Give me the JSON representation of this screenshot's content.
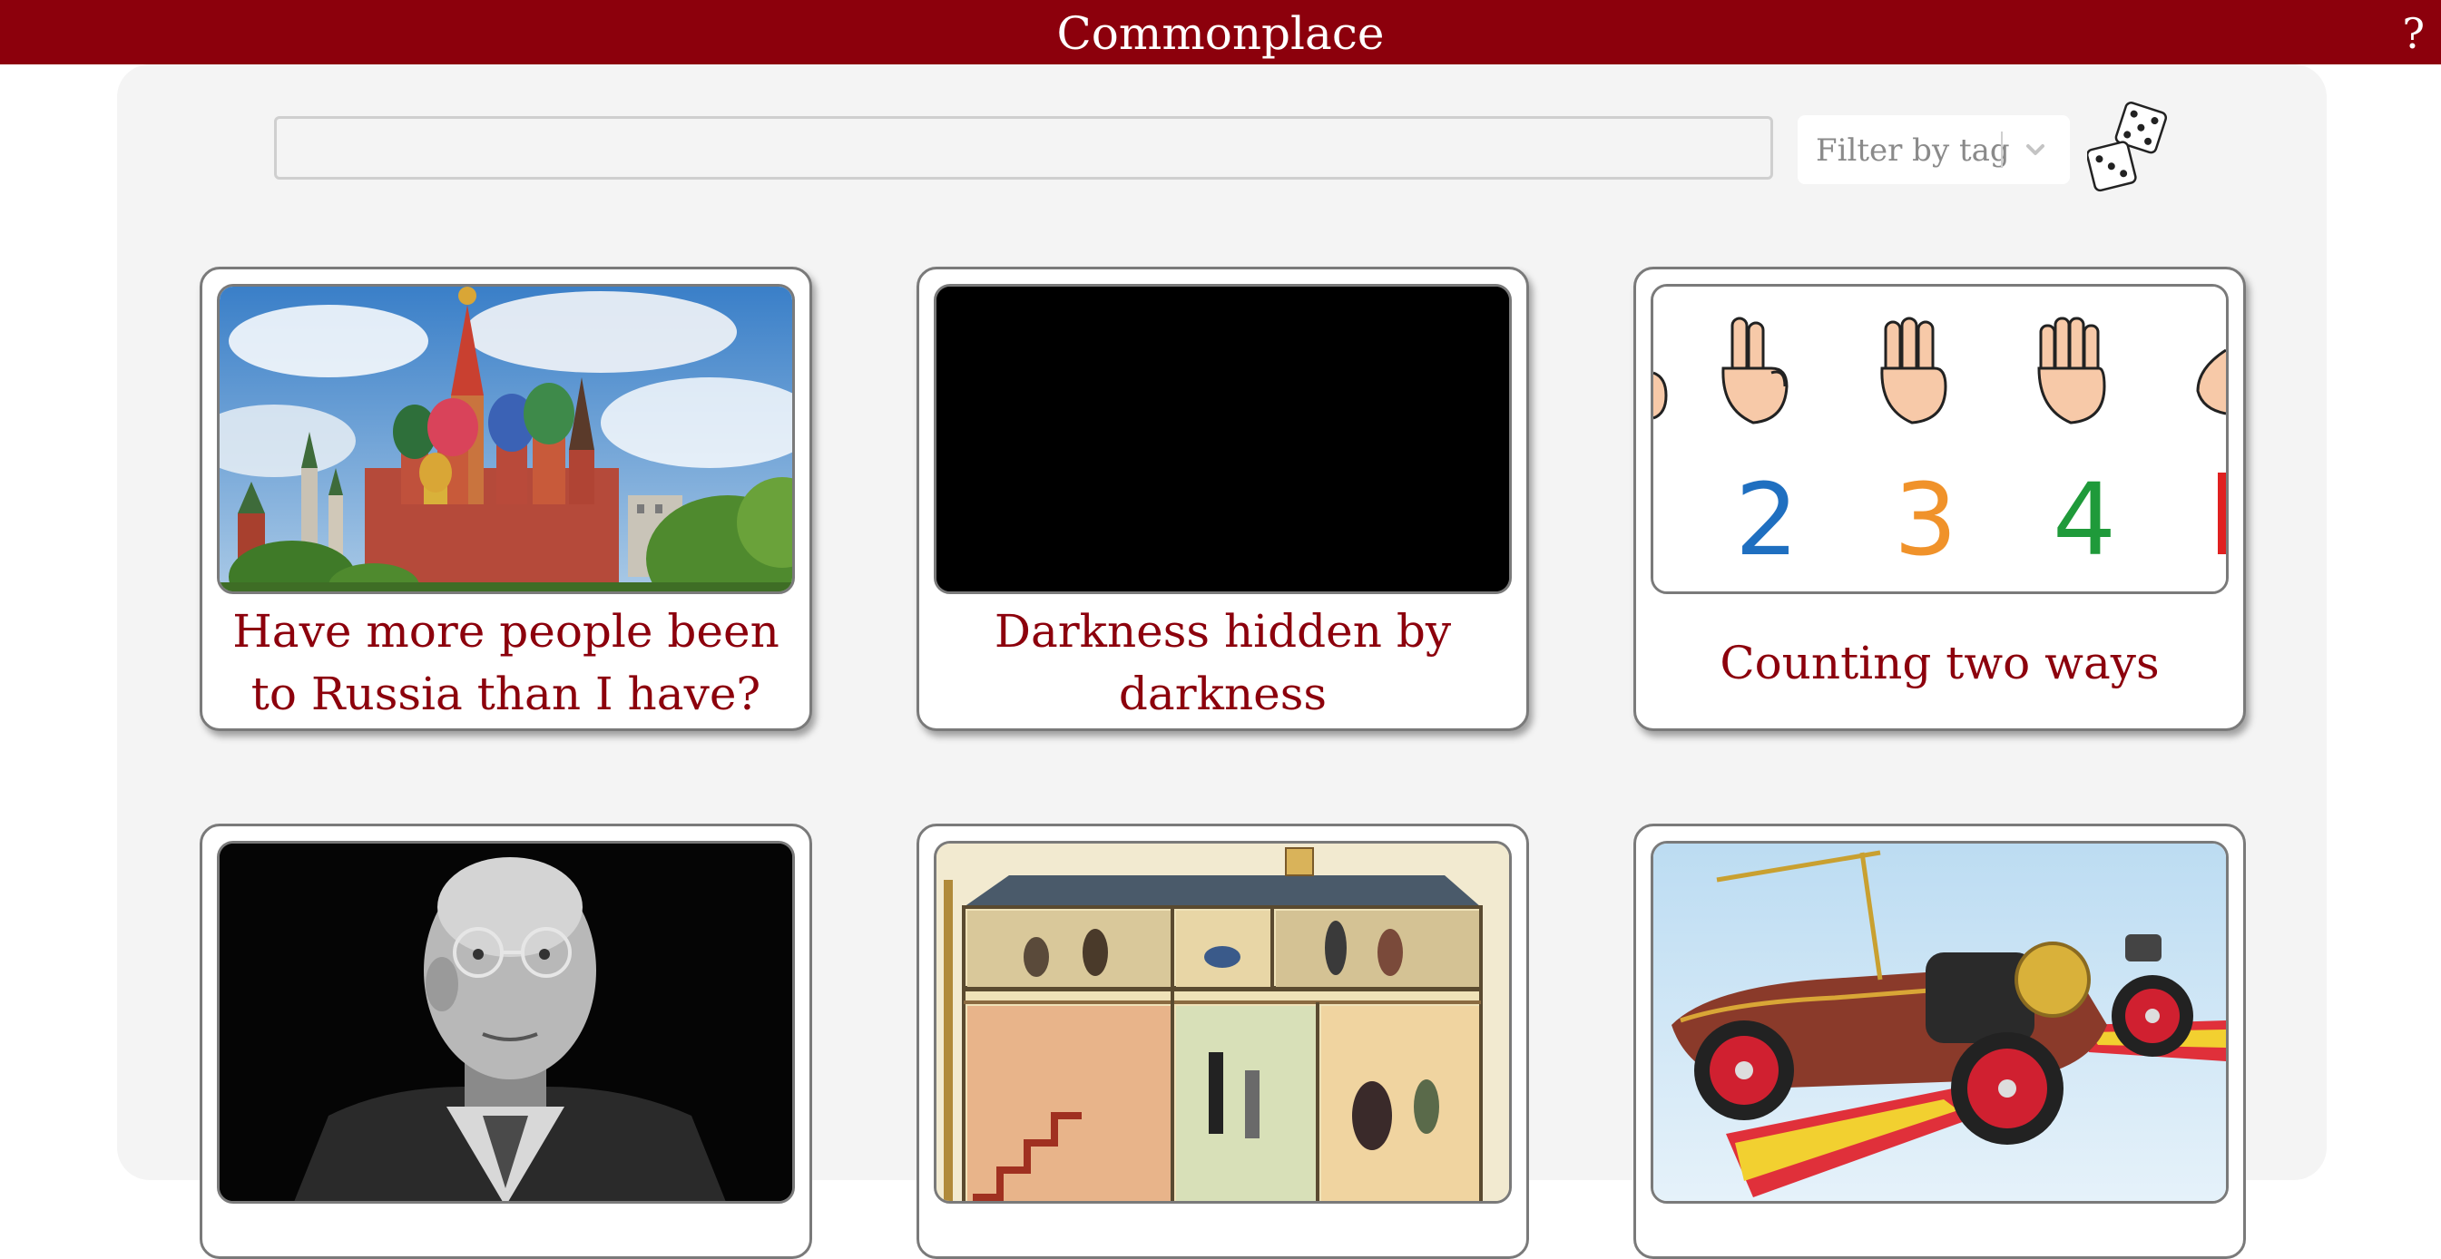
{
  "app": {
    "title": "Commonplace",
    "help_label": "?"
  },
  "search": {
    "value": "",
    "placeholder": ""
  },
  "filter": {
    "placeholder": "Filter by tag",
    "icon": "chevron-down-icon"
  },
  "random_button": {
    "icon": "dice-icon"
  },
  "colors": {
    "brand": "#8c000c",
    "panel": "#f4f4f4"
  },
  "cards": [
    {
      "title": "Have more people been to Russia than I have?",
      "image": "st-basils-cathedral-photo"
    },
    {
      "title": "Darkness hidden by darkness",
      "image": "black-image"
    },
    {
      "title": "Counting two ways",
      "image": "counting-hands-illustration"
    },
    {
      "title": "",
      "image": "portrait-man-glasses-photo"
    },
    {
      "title": "",
      "image": "house-cross-section-illustration"
    },
    {
      "title": "",
      "image": "flying-car-illustration"
    }
  ],
  "counting_numbers": [
    "2",
    "3",
    "4"
  ]
}
